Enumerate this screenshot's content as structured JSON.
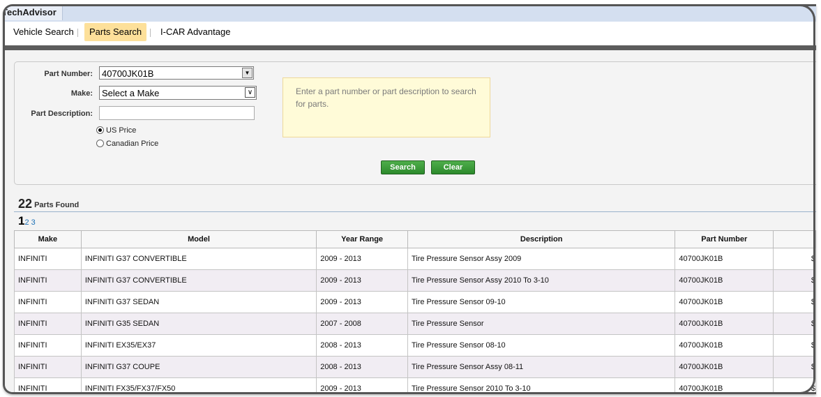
{
  "app": {
    "brand": "TechAdvisor"
  },
  "nav": {
    "items": [
      {
        "label": "Vehicle Search",
        "active": false
      },
      {
        "label": "Parts Search",
        "active": true
      },
      {
        "label": "I-CAR Advantage",
        "active": false
      }
    ]
  },
  "search": {
    "part_number_label": "Part Number:",
    "part_number_value": "40700JK01B",
    "make_label": "Make:",
    "make_value": "Select a Make",
    "description_label": "Part Description:",
    "description_value": "",
    "price_options": [
      {
        "label": "US Price",
        "selected": true
      },
      {
        "label": "Canadian Price",
        "selected": false
      }
    ],
    "hint": "Enter a part number or part description to search for parts.",
    "search_button": "Search",
    "clear_button": "Clear"
  },
  "results": {
    "count": "22",
    "count_label": "Parts Found",
    "pages": {
      "current": "1",
      "others": "2 3"
    },
    "columns": [
      "Make",
      "Model",
      "Year Range",
      "Description",
      "Part Number",
      ""
    ],
    "rows": [
      {
        "make": "INFINITI",
        "model": "INFINITI G37 CONVERTIBLE",
        "years": "2009 - 2013",
        "description": "Tire Pressure Sensor Assy 2009",
        "part_number": "40700JK01B",
        "price": "$"
      },
      {
        "make": "INFINITI",
        "model": "INFINITI G37 CONVERTIBLE",
        "years": "2009 - 2013",
        "description": "Tire Pressure Sensor Assy 2010 To 3-10",
        "part_number": "40700JK01B",
        "price": "$"
      },
      {
        "make": "INFINITI",
        "model": "INFINITI G37 SEDAN",
        "years": "2009 - 2013",
        "description": "Tire Pressure Sensor 09-10",
        "part_number": "40700JK01B",
        "price": "$"
      },
      {
        "make": "INFINITI",
        "model": "INFINITI G35 SEDAN",
        "years": "2007 - 2008",
        "description": "Tire Pressure Sensor",
        "part_number": "40700JK01B",
        "price": "$"
      },
      {
        "make": "INFINITI",
        "model": "INFINITI EX35/EX37",
        "years": "2008 - 2013",
        "description": "Tire Pressure Sensor 08-10",
        "part_number": "40700JK01B",
        "price": "$"
      },
      {
        "make": "INFINITI",
        "model": "INFINITI G37 COUPE",
        "years": "2008 - 2013",
        "description": "Tire Pressure Sensor Assy 08-11",
        "part_number": "40700JK01B",
        "price": "$"
      },
      {
        "make": "INFINITI",
        "model": "INFINITI FX35/FX37/FX50",
        "years": "2009 - 2013",
        "description": "Tire Pressure Sensor 2010 To 3-10",
        "part_number": "40700JK01B",
        "price": "$"
      }
    ]
  },
  "colors": {
    "active_tab": "#fde09a",
    "button_green": "#2c8a2c",
    "hint_bg": "#fffbd8",
    "row_alt": "#f1edf3"
  }
}
